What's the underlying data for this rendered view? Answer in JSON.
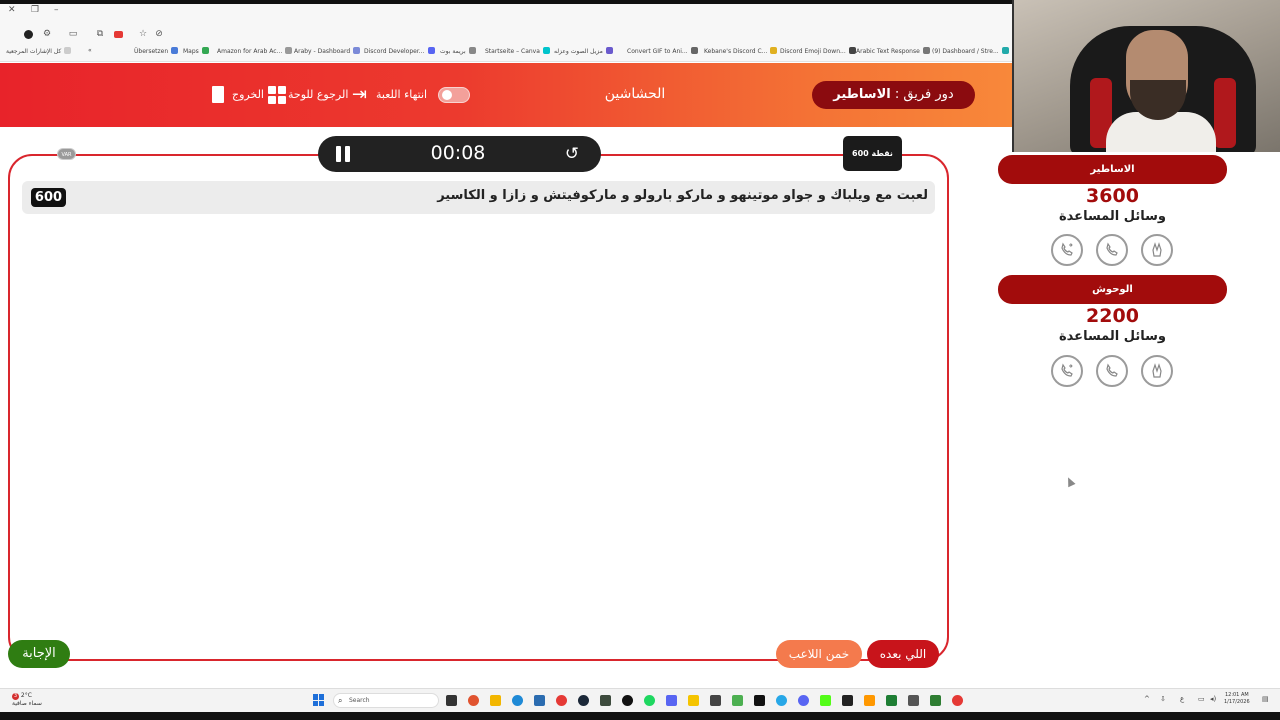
{
  "header": {
    "turn_prefix": "دور فريق :",
    "turn_team": "الاساطير",
    "game_title": "الحشاشين",
    "end_game_label": "انتهاء اللعبة",
    "back_to_board_label": "الرجوع للوحة",
    "exit_label": "الخروج"
  },
  "question": {
    "timer": "00:08",
    "points_badge": "600 نقطة",
    "var_badge": "VAR",
    "points": "600",
    "text": "لعبت مع ويلباك و جواو موتينهو و ماركو بارولو و ماركوفيتش و زازا و الكاسير"
  },
  "buttons": {
    "answer": "الإجابة",
    "guess_player": "خمن اللاعب",
    "next": "اللي بعده"
  },
  "teams": [
    {
      "name": "الاساطير",
      "score": "3600",
      "aids_label": "وسائل المساعدة"
    },
    {
      "name": "الوحوش",
      "score": "2200",
      "aids_label": "وسائل المساعدة"
    }
  ],
  "bookmarks": [
    "كل الإشارات المرجعية",
    "Übersetzen",
    "Maps",
    "Amazon for Arab Ac...",
    "Araby - Dashboard",
    "Discord Developer...",
    "بريمة بوت",
    "Startseite – Canva",
    "مزيل الصوت وعزله",
    "Convert GIF to Ani...",
    "Kebane's Discord C...",
    "Discord Emoji Down...",
    "Arabic Text Response",
    "(9) Dashboard / Stre..."
  ],
  "taskbar": {
    "weather_temp": "2°C",
    "weather_desc": "سماء صافية",
    "weather_badge": "3",
    "search_placeholder": "Search",
    "time": "12:01 AM",
    "date": "1/17/2026",
    "lang": "ع"
  },
  "colors": {
    "header_start": "#e8232a",
    "header_end": "#f8883a",
    "team_pill": "#a20c0c",
    "answer_button": "#2f7d12",
    "guess_button": "#f47a4d",
    "next_button": "#c8141b"
  }
}
